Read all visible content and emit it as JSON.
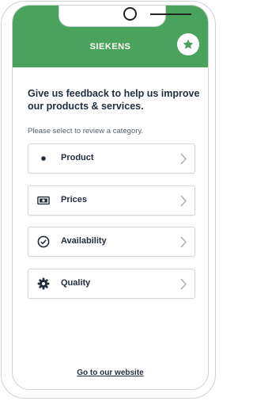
{
  "app": {
    "title": "SIEKENS"
  },
  "header": {
    "star_icon": "star-icon",
    "accent_color": "#4aa35c"
  },
  "intro": {
    "heading": "Give us feedback to help us improve our products & services.",
    "subtext": "Please select to review a category."
  },
  "categories": [
    {
      "label": "Product",
      "icon": "bullet-icon"
    },
    {
      "label": "Prices",
      "icon": "banknote-icon"
    },
    {
      "label": "Availability",
      "icon": "check-circle-icon"
    },
    {
      "label": "Quality",
      "icon": "gear-icon"
    }
  ],
  "footer": {
    "link_label": "Go to our website"
  }
}
